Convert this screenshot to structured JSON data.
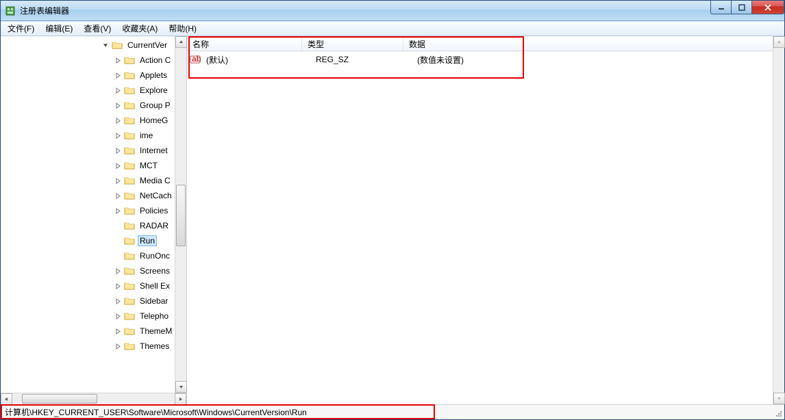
{
  "window": {
    "title": "注册表编辑器"
  },
  "menus": {
    "file": "文件(F)",
    "edit": "编辑(E)",
    "view": "查看(V)",
    "favorites": "收藏夹(A)",
    "help": "帮助(H)"
  },
  "tree": {
    "top_label": "CurrentVer",
    "nodes": [
      {
        "label": "Action C",
        "expander": "closed"
      },
      {
        "label": "Applets",
        "expander": "closed"
      },
      {
        "label": "Explore",
        "expander": "closed"
      },
      {
        "label": "Group P",
        "expander": "closed"
      },
      {
        "label": "HomeG",
        "expander": "closed"
      },
      {
        "label": "ime",
        "expander": "closed"
      },
      {
        "label": "Internet",
        "expander": "closed"
      },
      {
        "label": "MCT",
        "expander": "closed"
      },
      {
        "label": "Media C",
        "expander": "closed"
      },
      {
        "label": "NetCach",
        "expander": "closed"
      },
      {
        "label": "Policies",
        "expander": "closed"
      },
      {
        "label": "RADAR",
        "expander": "none"
      },
      {
        "label": "Run",
        "expander": "none",
        "selected": true
      },
      {
        "label": "RunOnc",
        "expander": "none"
      },
      {
        "label": "Screens",
        "expander": "closed"
      },
      {
        "label": "Shell Ex",
        "expander": "closed"
      },
      {
        "label": "Sidebar",
        "expander": "closed"
      },
      {
        "label": "Telepho",
        "expander": "closed"
      },
      {
        "label": "ThemeM",
        "expander": "closed"
      },
      {
        "label": "Themes",
        "expander": "closed"
      }
    ]
  },
  "list": {
    "columns": {
      "name": "名称",
      "type": "类型",
      "data": "数据"
    },
    "rows": [
      {
        "name": "(默认)",
        "type": "REG_SZ",
        "data": "(数值未设置)"
      }
    ]
  },
  "statusbar": {
    "path": "计算机\\HKEY_CURRENT_USER\\Software\\Microsoft\\Windows\\CurrentVersion\\Run"
  }
}
